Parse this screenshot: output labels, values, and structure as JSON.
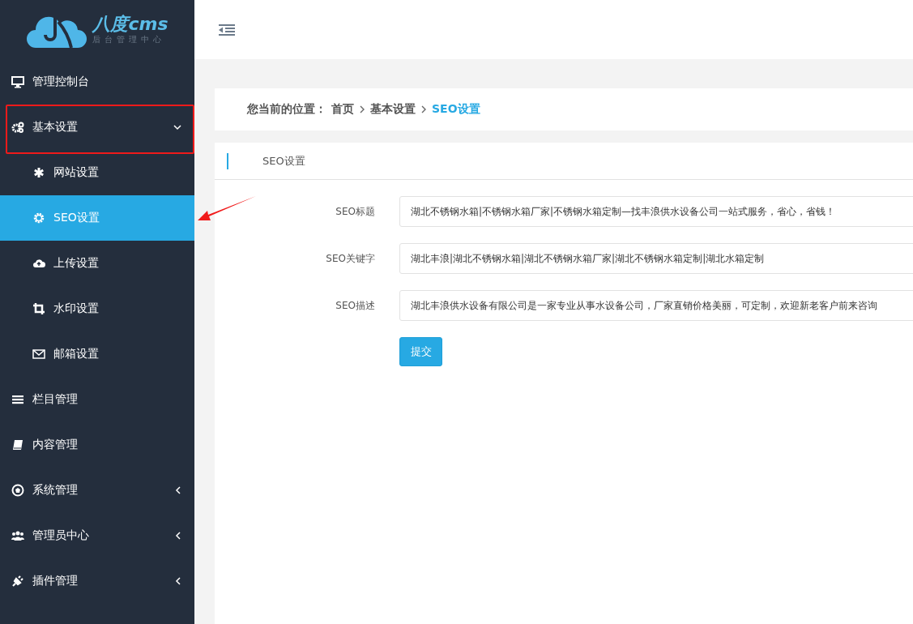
{
  "logo": {
    "title": "八度cms",
    "subtitle": "后台管理中心"
  },
  "sidebar": {
    "items": [
      {
        "label": "管理控制台",
        "kind": "link",
        "selected": false,
        "highlighted": false
      },
      {
        "label": "基本设置",
        "kind": "group",
        "expanded": true,
        "selected": false,
        "highlighted": true,
        "children": [
          {
            "label": "网站设置",
            "selected": false
          },
          {
            "label": "SEO设置",
            "selected": true
          },
          {
            "label": "上传设置",
            "selected": false
          },
          {
            "label": "水印设置",
            "selected": false
          },
          {
            "label": "邮箱设置",
            "selected": false
          }
        ]
      },
      {
        "label": "栏目管理",
        "kind": "link",
        "selected": false,
        "highlighted": false
      },
      {
        "label": "内容管理",
        "kind": "link",
        "selected": false,
        "highlighted": false
      },
      {
        "label": "系统管理",
        "kind": "group",
        "expanded": false,
        "selected": false,
        "highlighted": false
      },
      {
        "label": "管理员中心",
        "kind": "group",
        "expanded": false,
        "selected": false,
        "highlighted": false
      },
      {
        "label": "插件管理",
        "kind": "group",
        "expanded": false,
        "selected": false,
        "highlighted": false
      }
    ]
  },
  "breadcrumb": {
    "prefix": "您当前的位置：",
    "items": [
      "首页",
      "基本设置"
    ],
    "current": "SEO设置"
  },
  "card": {
    "title": "SEO设置"
  },
  "form": {
    "fields": [
      {
        "label": "SEO标题",
        "value": "湖北不锈钢水箱|不锈钢水箱厂家|不锈钢水箱定制—找丰浪供水设备公司一站式服务，省心，省钱！"
      },
      {
        "label": "SEO关键字",
        "value": "湖北丰浪|湖北不锈钢水箱|湖北不锈钢水箱厂家|湖北不锈钢水箱定制|湖北水箱定制"
      },
      {
        "label": "SEO描述",
        "value": "湖北丰浪供水设备有限公司是一家专业从事水设备公司，厂家直销价格美丽，可定制，欢迎新老客户前来咨询"
      }
    ],
    "submit": "提交"
  },
  "annotation": {
    "arrow": true
  }
}
